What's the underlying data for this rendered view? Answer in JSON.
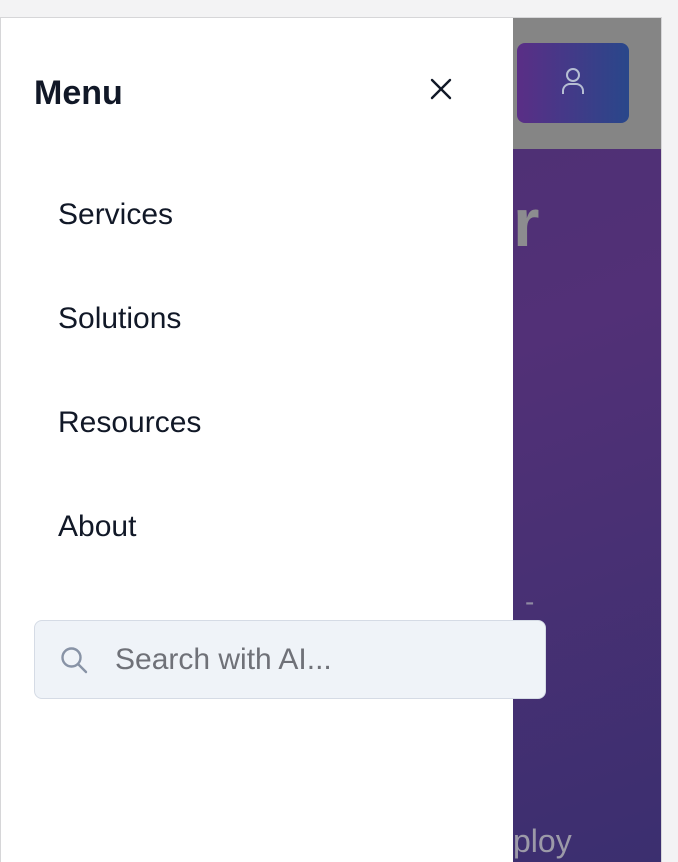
{
  "header": {
    "background_color": "#858585",
    "user_button": {
      "icon": "user-icon",
      "gradient": [
        "#5a2e86",
        "#29478a"
      ]
    }
  },
  "hero": {
    "partial_heading_glyph": "r",
    "partial_dash": "-",
    "partial_bottom_text": "ploy"
  },
  "drawer": {
    "title": "Menu",
    "close_icon": "close-icon",
    "items": [
      {
        "label": "Services"
      },
      {
        "label": "Solutions"
      },
      {
        "label": "Resources"
      },
      {
        "label": "About"
      }
    ],
    "search": {
      "icon": "search-icon",
      "placeholder": "Search with AI...",
      "value": ""
    }
  },
  "colors": {
    "text_primary": "#111827",
    "search_bg": "#eff3f8",
    "search_border": "#d5dbe5"
  }
}
